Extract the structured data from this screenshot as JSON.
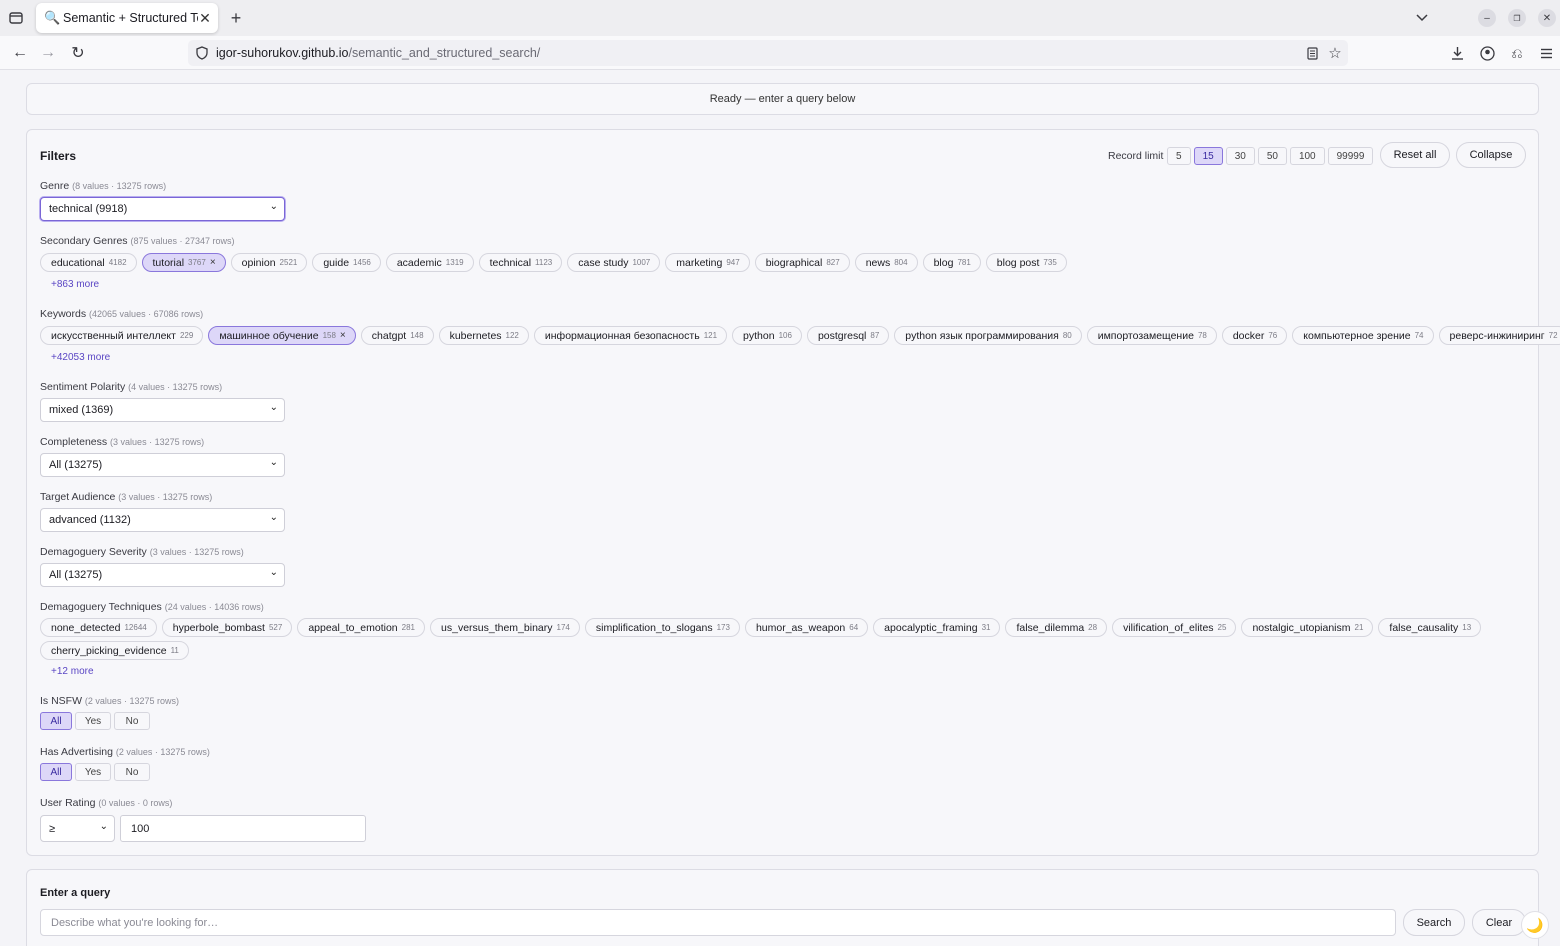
{
  "browser": {
    "tab_title": "Semantic + Structured Te",
    "url_host": "igor-suhorukov.github.io",
    "url_path": "/semantic_and_structured_search/"
  },
  "status": "Ready — enter a query below",
  "filters": {
    "title": "Filters",
    "record_limit_label": "Record limit",
    "record_limits": [
      "5",
      "15",
      "30",
      "50",
      "100",
      "99999"
    ],
    "record_limit_selected": "15",
    "reset_label": "Reset all",
    "collapse_label": "Collapse",
    "genre": {
      "label": "Genre",
      "meta": "(8 values · 13275 rows)",
      "value": "technical (9918)"
    },
    "secondary_genres": {
      "label": "Secondary Genres",
      "meta": "(875 values · 27347 rows)",
      "chips": [
        {
          "name": "educational",
          "count": "4182"
        },
        {
          "name": "tutorial",
          "count": "3767",
          "selected": true
        },
        {
          "name": "opinion",
          "count": "2521"
        },
        {
          "name": "guide",
          "count": "1456"
        },
        {
          "name": "academic",
          "count": "1319"
        },
        {
          "name": "technical",
          "count": "1123"
        },
        {
          "name": "case study",
          "count": "1007"
        },
        {
          "name": "marketing",
          "count": "947"
        },
        {
          "name": "biographical",
          "count": "827"
        },
        {
          "name": "news",
          "count": "804"
        },
        {
          "name": "blog",
          "count": "781"
        },
        {
          "name": "blog post",
          "count": "735"
        }
      ],
      "more": "+863 more"
    },
    "keywords": {
      "label": "Keywords",
      "meta": "(42065 values · 67086 rows)",
      "chips": [
        {
          "name": "искусственный интеллект",
          "count": "229"
        },
        {
          "name": "машинное обучение",
          "count": "158",
          "selected": true
        },
        {
          "name": "chatgpt",
          "count": "148"
        },
        {
          "name": "kubernetes",
          "count": "122"
        },
        {
          "name": "информационная безопасность",
          "count": "121"
        },
        {
          "name": "python",
          "count": "106"
        },
        {
          "name": "postgresql",
          "count": "87"
        },
        {
          "name": "python язык программирования",
          "count": "80"
        },
        {
          "name": "импортозамещение",
          "count": "78"
        },
        {
          "name": "docker",
          "count": "76"
        },
        {
          "name": "компьютерное зрение",
          "count": "74"
        },
        {
          "name": "реверс-инжиниринг",
          "count": "72"
        }
      ],
      "more": "+42053 more"
    },
    "sentiment": {
      "label": "Sentiment Polarity",
      "meta": "(4 values · 13275 rows)",
      "value": "mixed (1369)"
    },
    "completeness": {
      "label": "Completeness",
      "meta": "(3 values · 13275 rows)",
      "value": "All (13275)"
    },
    "audience": {
      "label": "Target Audience",
      "meta": "(3 values · 13275 rows)",
      "value": "advanced (1132)"
    },
    "demagoguery_severity": {
      "label": "Demagoguery Severity",
      "meta": "(3 values · 13275 rows)",
      "value": "All (13275)"
    },
    "demagoguery_techniques": {
      "label": "Demagoguery Techniques",
      "meta": "(24 values · 14036 rows)",
      "chips": [
        {
          "name": "none_detected",
          "count": "12644"
        },
        {
          "name": "hyperbole_bombast",
          "count": "527"
        },
        {
          "name": "appeal_to_emotion",
          "count": "281"
        },
        {
          "name": "us_versus_them_binary",
          "count": "174"
        },
        {
          "name": "simplification_to_slogans",
          "count": "173"
        },
        {
          "name": "humor_as_weapon",
          "count": "64"
        },
        {
          "name": "apocalyptic_framing",
          "count": "31"
        },
        {
          "name": "false_dilemma",
          "count": "28"
        },
        {
          "name": "vilification_of_elites",
          "count": "25"
        },
        {
          "name": "nostalgic_utopianism",
          "count": "21"
        },
        {
          "name": "false_causality",
          "count": "13"
        }
      ],
      "chips2": [
        {
          "name": "cherry_picking_evidence",
          "count": "11"
        }
      ],
      "more": "+12 more"
    },
    "nsfw": {
      "label": "Is NSFW",
      "meta": "(2 values · 13275 rows)",
      "options": [
        "All",
        "Yes",
        "No"
      ],
      "selected": "All"
    },
    "advertising": {
      "label": "Has Advertising",
      "meta": "(2 values · 13275 rows)",
      "options": [
        "All",
        "Yes",
        "No"
      ],
      "selected": "All"
    },
    "rating": {
      "label": "User Rating",
      "meta": "(0 values · 0 rows)",
      "operator": "≥",
      "value": "100"
    }
  },
  "query": {
    "title": "Enter a query",
    "placeholder": "Describe what you're looking for…",
    "search_label": "Search",
    "clear_label": "Clear"
  },
  "colors": {
    "accent": "#7a66d6",
    "chip_selected": "#ddd7f8",
    "link": "#5a46c4"
  }
}
